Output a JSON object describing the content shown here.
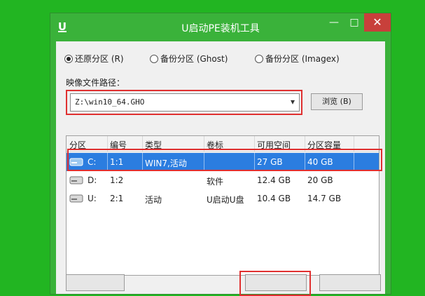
{
  "window": {
    "title": "U启动PE装机工具",
    "icon": "u-logo-icon"
  },
  "titlebar": {
    "min_glyph": "—",
    "max_glyph": "□",
    "close_glyph": "✕"
  },
  "options": {
    "restore": "还原分区 (R)",
    "backup": "备份分区 (Ghost)",
    "backup_imagex": "备份分区 (Imagex)",
    "selected": "restore"
  },
  "image_path": {
    "label": "映像文件路径：",
    "value": "Z:\\win10_64.GHO",
    "browse_label": "浏览 (B)"
  },
  "partitions": {
    "headers": [
      "分区",
      "编号",
      "类型",
      "卷标",
      "可用空间",
      "分区容量"
    ],
    "rows": [
      {
        "drive": "C:",
        "id": "1:1",
        "type": "WIN7,活动",
        "label": "",
        "free": "27 GB",
        "size": "40 GB",
        "selected": true
      },
      {
        "drive": "D:",
        "id": "1:2",
        "type": "",
        "label": "软件",
        "free": "12.4 GB",
        "size": "20 GB",
        "selected": false
      },
      {
        "drive": "U:",
        "id": "2:1",
        "type": "活动",
        "label": "U启动U盘",
        "free": "10.4 GB",
        "size": "14.7 GB",
        "selected": false
      }
    ]
  },
  "colors": {
    "accent": "#2b7de0",
    "highlight": "#e03030",
    "window": "#3ab23a",
    "close": "#c8403b"
  }
}
